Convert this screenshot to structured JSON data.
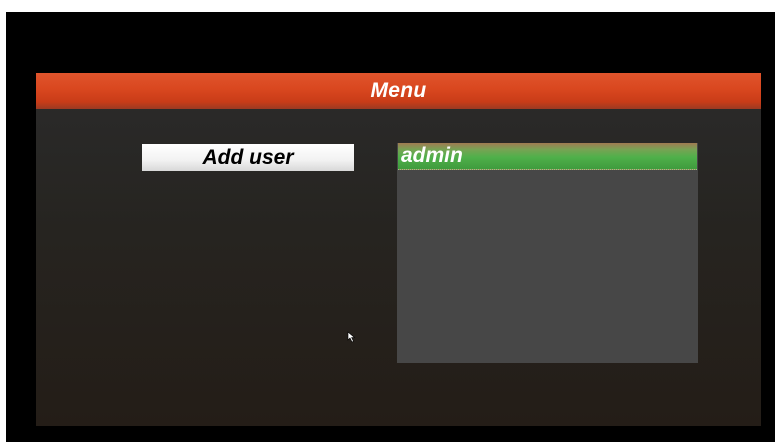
{
  "menu": {
    "title": "Menu",
    "add_user_label": "Add user",
    "users": [
      {
        "label": "admin",
        "selected": true
      }
    ]
  },
  "colors": {
    "header": "#d9471f",
    "panel": "#2b2b2b",
    "selection": "#4fb04a",
    "list_background": "#474747"
  },
  "icons": {
    "cursor": "mouse-pointer-icon"
  }
}
